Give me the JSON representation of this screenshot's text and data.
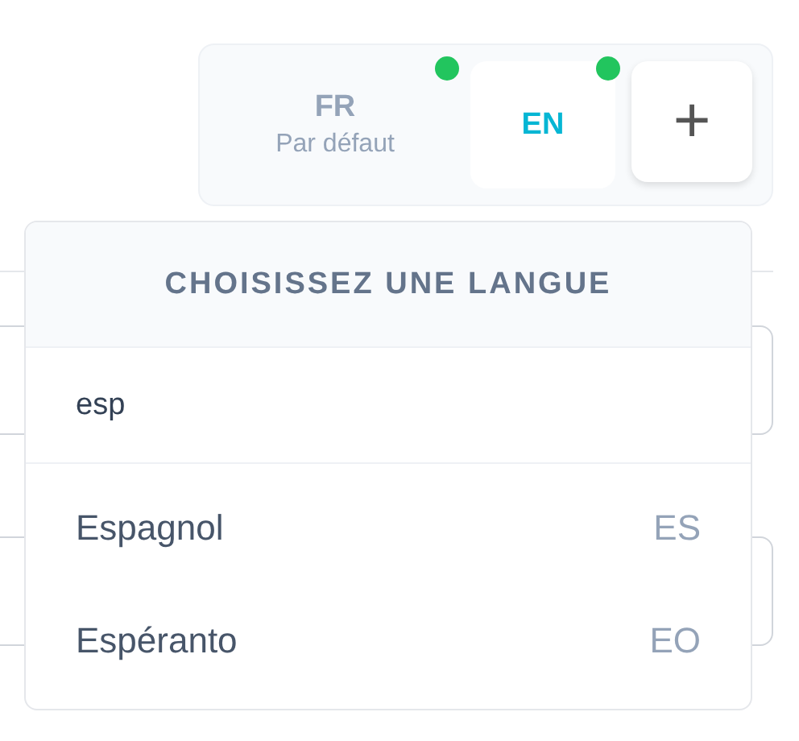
{
  "language_tabs": [
    {
      "code": "FR",
      "caption": "Par défaut",
      "selected": false,
      "active": true
    },
    {
      "code": "EN",
      "selected": true,
      "active": true
    }
  ],
  "add_button": {
    "label": "+"
  },
  "language_menu": {
    "title": "CHOISISSEZ UNE LANGUE",
    "search": {
      "value": "esp"
    },
    "options": [
      {
        "name": "Espagnol",
        "code": "ES"
      },
      {
        "name": "Espéranto",
        "code": "EO"
      }
    ]
  }
}
